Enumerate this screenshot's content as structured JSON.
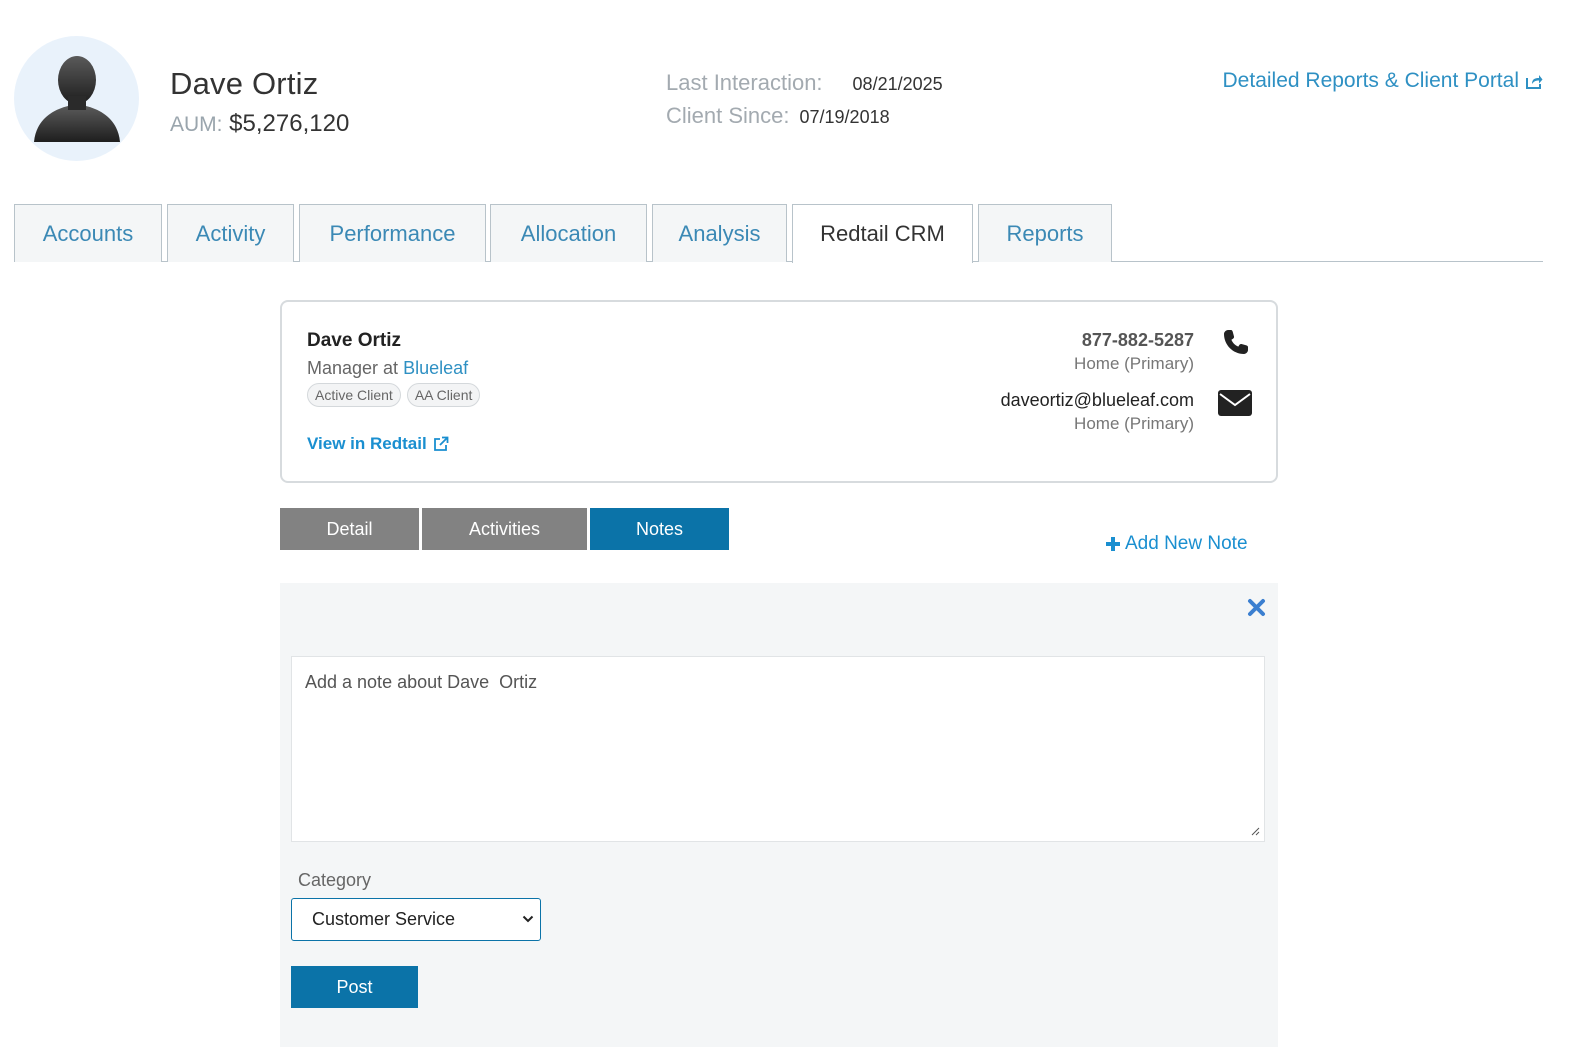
{
  "header": {
    "client_name": "Dave Ortiz",
    "aum_label": "AUM:",
    "aum_value": "$5,276,120",
    "last_interaction_label": "Last Interaction:",
    "last_interaction_value": "08/21/2025",
    "client_since_label": "Client Since:",
    "client_since_value": "07/19/2018",
    "portal_link": "Detailed Reports & Client Portal"
  },
  "tabs": [
    {
      "label": "Accounts"
    },
    {
      "label": "Activity"
    },
    {
      "label": "Performance"
    },
    {
      "label": "Allocation"
    },
    {
      "label": "Analysis"
    },
    {
      "label": "Redtail CRM",
      "active": true
    },
    {
      "label": "Reports"
    }
  ],
  "contact": {
    "name": "Dave Ortiz",
    "title_prefix": "Manager at",
    "company": "Blueleaf",
    "badges": [
      "Active Client",
      "AA Client"
    ],
    "view_link": "View in Redtail",
    "phone": "877-882-5287",
    "phone_type": "Home (Primary)",
    "email": "daveortiz@blueleaf.com",
    "email_type": "Home (Primary)"
  },
  "subtabs": [
    {
      "label": "Detail"
    },
    {
      "label": "Activities"
    },
    {
      "label": "Notes",
      "active": true
    }
  ],
  "add_note_label": "Add New Note",
  "note_form": {
    "placeholder": "Add a note about Dave  Ortiz",
    "category_label": "Category",
    "category_value": "Customer Service",
    "post_label": "Post"
  },
  "colors": {
    "accent": "#0b73a8",
    "link": "#2e90c3",
    "tab_text": "#3b89b5",
    "subtab_inactive": "#828282",
    "panel_bg": "#f4f6f7"
  },
  "icons": [
    "avatar-silhouette-icon",
    "external-link-icon",
    "phone-icon",
    "envelope-icon",
    "plus-icon",
    "close-icon",
    "chevron-down-icon"
  ]
}
